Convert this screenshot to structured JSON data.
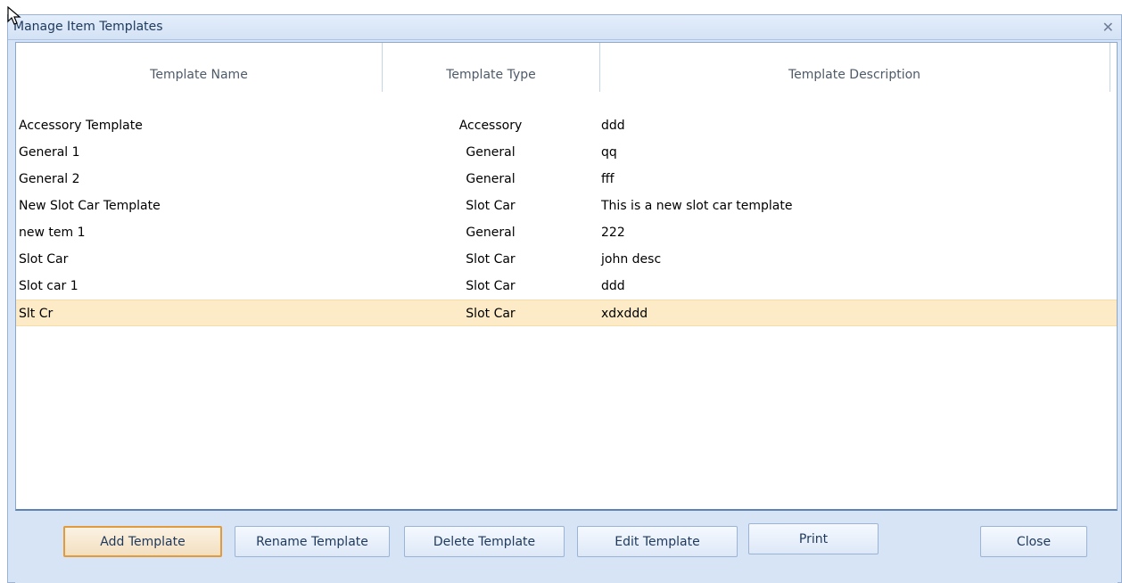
{
  "window": {
    "title": "Manage Item Templates",
    "close_glyph": "✕"
  },
  "grid": {
    "columns": [
      "Template Name",
      "Template Type",
      "Template Description"
    ],
    "rows": [
      {
        "name": "Accessory Template",
        "type": "Accessory",
        "description": "ddd",
        "selected": false
      },
      {
        "name": "General 1",
        "type": "General",
        "description": "qq",
        "selected": false
      },
      {
        "name": "General 2",
        "type": "General",
        "description": "fff",
        "selected": false
      },
      {
        "name": "New Slot Car Template",
        "type": "Slot Car",
        "description": "This is a new slot car template",
        "selected": false
      },
      {
        "name": "new tem 1",
        "type": "General",
        "description": "222",
        "selected": false
      },
      {
        "name": "Slot Car",
        "type": "Slot Car",
        "description": "john desc",
        "selected": false
      },
      {
        "name": "Slot car 1",
        "type": "Slot Car",
        "description": "ddd",
        "selected": false
      },
      {
        "name": "Slt Cr",
        "type": "Slot Car",
        "description": "xdxddd",
        "selected": true
      }
    ]
  },
  "buttons": {
    "add": "Add Template",
    "rename": "Rename Template",
    "delete": "Delete Template",
    "edit": "Edit Template",
    "print": "Print",
    "close": "Close"
  },
  "colors": {
    "selected_row": "#fcebc6",
    "default_button_border": "#e39a3c",
    "title_text": "#1e395b"
  }
}
